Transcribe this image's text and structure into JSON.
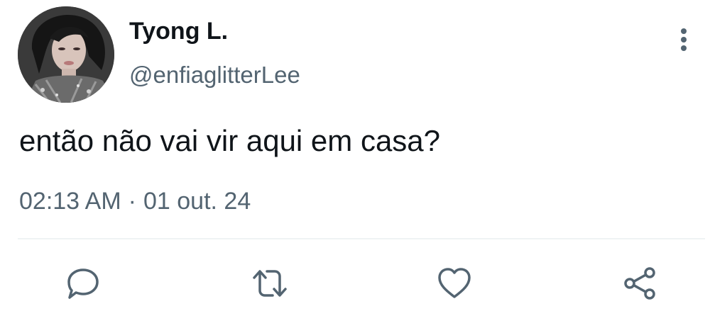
{
  "tweet": {
    "author": {
      "display_name": "Tyong L.",
      "handle": "@enfiaglitterLee"
    },
    "text": "então não vai vir aqui em casa?",
    "time": "02:13 AM",
    "separator": "·",
    "date": "01 out. 24"
  },
  "actions": [
    {
      "name": "reply",
      "icon": "speech-bubble-icon"
    },
    {
      "name": "retweet",
      "icon": "retweet-arrows-icon"
    },
    {
      "name": "like",
      "icon": "heart-icon"
    },
    {
      "name": "share",
      "icon": "share-nodes-icon"
    }
  ],
  "colors": {
    "primary_text": "#0f1419",
    "secondary_text": "#536471",
    "divider": "#eff3f4"
  }
}
